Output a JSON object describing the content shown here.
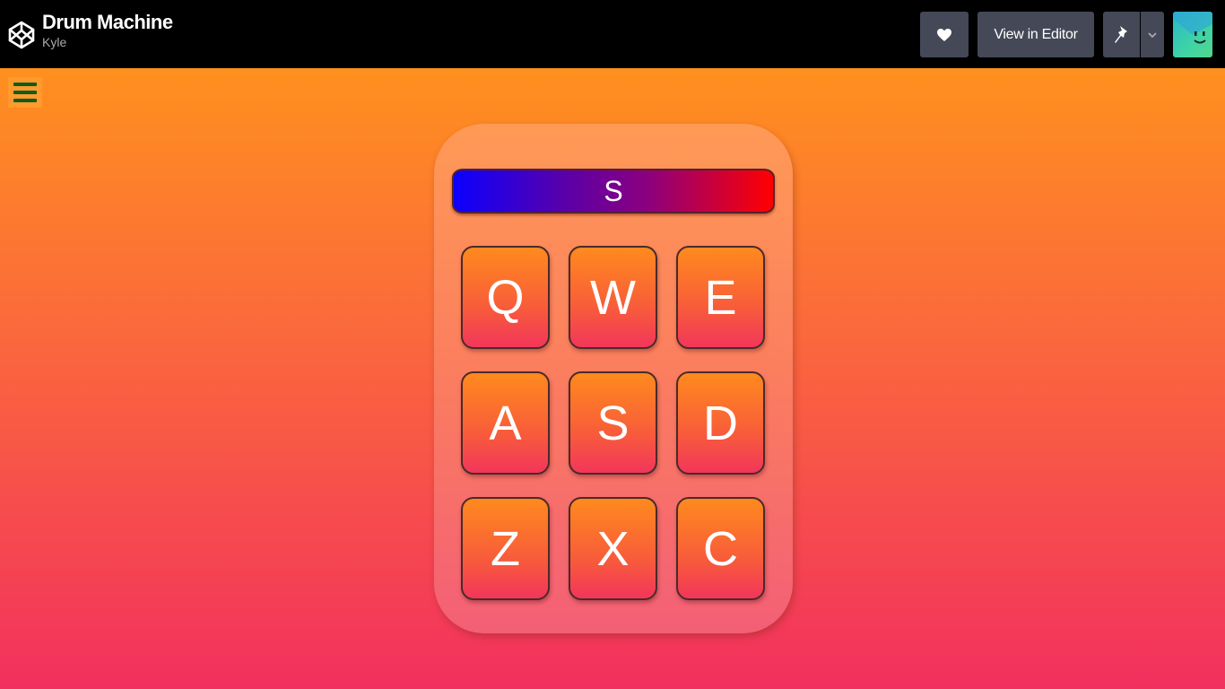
{
  "header": {
    "title": "Drum Machine",
    "author": "Kyle",
    "logo_icon": "codepen-logo-icon",
    "heart_icon": "heart-icon",
    "editor_label": "View in Editor",
    "pin_icon": "pin-icon",
    "caret_icon": "chevron-down-icon",
    "avatar_icon": "user-avatar"
  },
  "menu": {
    "icon": "hamburger-menu-icon"
  },
  "drum_machine": {
    "display_text": "S",
    "pads": {
      "q": "Q",
      "w": "W",
      "e": "E",
      "a": "A",
      "s": "S",
      "d": "D",
      "z": "Z",
      "x": "X",
      "c": "C"
    }
  },
  "colors": {
    "background_top": "#ff901e",
    "background_bottom": "#f2305e",
    "display_left": "#0b00ff",
    "display_right": "#ff0000",
    "menu_lines": "#0b5e1c"
  }
}
